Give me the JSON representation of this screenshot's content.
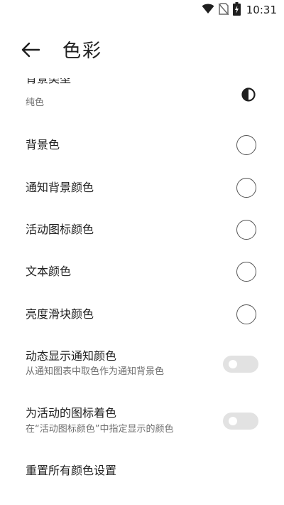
{
  "status_bar": {
    "time": "10:31"
  },
  "header": {
    "title": "色彩",
    "back_icon": "arrow-left-icon"
  },
  "settings": {
    "background_type": {
      "title": "背景类型",
      "summary": "纯色",
      "icon": "contrast-icon"
    },
    "background_color": {
      "title": "背景色"
    },
    "notification_background_color": {
      "title": "通知背景颜色"
    },
    "active_icon_color": {
      "title": "活动图标颜色"
    },
    "text_color": {
      "title": "文本颜色"
    },
    "brightness_slider_color": {
      "title": "亮度滑块颜色"
    },
    "dynamic_notification_color": {
      "title": "动态显示通知颜色",
      "summary": "从通知图表中取色作为通知背景色",
      "enabled": false
    },
    "tint_active_icons": {
      "title": "为活动的图标着色",
      "summary": "在“活动图标颜色”中指定显示的颜色",
      "enabled": false
    },
    "reset_colors": {
      "title": "重置所有颜色设置"
    }
  },
  "colors": {
    "toggle_track_off": "#e2e2e2",
    "swatch_border": "#555555"
  }
}
